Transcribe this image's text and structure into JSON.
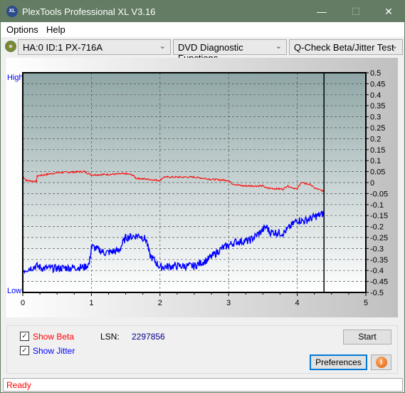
{
  "window": {
    "title": "PlexTools Professional XL V3.16",
    "logo_text": "XL",
    "minimize": "—",
    "maximize": "☐",
    "close": "✕"
  },
  "menu": [
    "Options",
    "Help"
  ],
  "toolbar": {
    "drive": "HA:0 ID:1  PX-716A",
    "function": "DVD Diagnostic Functions",
    "test": "Q-Check Beta/Jitter Test"
  },
  "chart_data": {
    "type": "line",
    "left_labels": {
      "high": "High",
      "low": "Low"
    },
    "xlim": [
      0,
      5
    ],
    "x_ticks": [
      "0",
      "1",
      "2",
      "3",
      "4",
      "5"
    ],
    "ylim": [
      -0.5,
      0.5
    ],
    "y_ticks": [
      "0.5",
      "0.45",
      "0.4",
      "0.35",
      "0.3",
      "0.25",
      "0.2",
      "0.15",
      "0.1",
      "0.05",
      "0",
      "-0.05",
      "-0.1",
      "-0.15",
      "-0.2",
      "-0.25",
      "-0.3",
      "-0.35",
      "-0.4",
      "-0.45",
      "-0.5"
    ],
    "grid": true,
    "cursor_x": 4.39,
    "series": [
      {
        "name": "Beta",
        "color": "#ff0000",
        "x": [
          0,
          0.05,
          0.2,
          0.21,
          0.5,
          0.9,
          1.0,
          1.5,
          1.6,
          1.65,
          2.0,
          2.05,
          2.5,
          2.75,
          3.0,
          3.05,
          3.2,
          3.5,
          3.55,
          3.8,
          3.85,
          4.0,
          4.05,
          4.2,
          4.25,
          4.39
        ],
        "y": [
          0.03,
          0.01,
          0.005,
          0.03,
          0.045,
          0.05,
          0.035,
          0.04,
          0.035,
          0.02,
          0.01,
          0.025,
          0.025,
          0.015,
          0.01,
          -0.005,
          -0.015,
          -0.015,
          -0.025,
          -0.03,
          -0.015,
          -0.03,
          0.0,
          -0.01,
          -0.025,
          -0.04
        ]
      },
      {
        "name": "Jitter",
        "color": "#0000ff",
        "x": [
          0,
          0.2,
          0.3,
          0.5,
          0.9,
          0.97,
          1.0,
          1.2,
          1.4,
          1.5,
          1.7,
          1.8,
          1.85,
          2.0,
          2.2,
          2.5,
          2.7,
          2.9,
          3.1,
          3.3,
          3.45,
          3.55,
          3.6,
          3.8,
          4.0,
          4.1,
          4.3,
          4.39
        ],
        "y": [
          -0.4,
          -0.38,
          -0.39,
          -0.39,
          -0.385,
          -0.37,
          -0.29,
          -0.32,
          -0.31,
          -0.25,
          -0.24,
          -0.26,
          -0.33,
          -0.385,
          -0.38,
          -0.38,
          -0.35,
          -0.3,
          -0.27,
          -0.265,
          -0.23,
          -0.2,
          -0.225,
          -0.23,
          -0.17,
          -0.175,
          -0.15,
          -0.14
        ]
      }
    ]
  },
  "controls": {
    "show_beta": "Show Beta",
    "show_beta_checked": true,
    "show_jitter": "Show Jitter",
    "show_jitter_checked": true,
    "lsn_label": "LSN:",
    "lsn_value": "2297856",
    "start": "Start",
    "preferences": "Preferences",
    "info_icon": "info-icon"
  },
  "status": "Ready"
}
